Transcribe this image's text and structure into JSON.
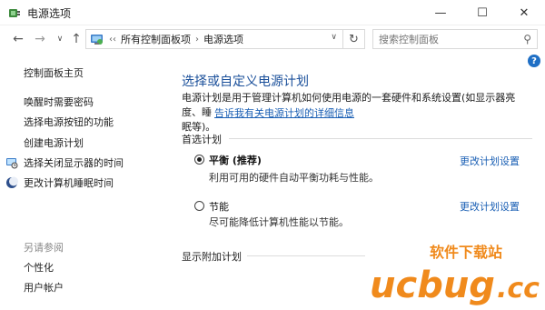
{
  "window": {
    "title": "电源选项",
    "minimize_glyph": "—",
    "maximize_glyph": "☐",
    "close_glyph": "✕"
  },
  "addressbar": {
    "back_glyph": "←",
    "forward_glyph": "→",
    "dropdown_glyph": "∨",
    "up_glyph": "↑",
    "breadcrumb_prefix": "‹‹",
    "breadcrumb_separator": "›",
    "breadcrumbs": [
      "所有控制面板项",
      "电源选项"
    ],
    "path_dropdown_glyph": "∨",
    "refresh_glyph": "↻",
    "search_placeholder": "搜索控制面板",
    "search_icon_glyph": "⚲"
  },
  "sidebar": {
    "home_label": "控制面板主页",
    "items": [
      {
        "label": "唤醒时需要密码",
        "icon": ""
      },
      {
        "label": "选择电源按钮的功能",
        "icon": ""
      },
      {
        "label": "创建电源计划",
        "icon": ""
      },
      {
        "label": "选择关闭显示器的时间",
        "icon": "display-icon"
      },
      {
        "label": "更改计算机睡眠时间",
        "icon": "moon-icon"
      }
    ],
    "see_also_heading": "另请参阅",
    "see_also": [
      {
        "label": "个性化"
      },
      {
        "label": "用户帐户"
      }
    ]
  },
  "main": {
    "help_glyph": "?",
    "title": "选择或自定义电源计划",
    "description_line1": "电源计划是用于管理计算机如何使用电源的一套硬件和系统设置(如显示器亮度、睡",
    "description_line2_prefix": "眠等)。",
    "description_link": "告诉我有关电源计划的详细信息",
    "preferred_heading": "首选计划",
    "plans": [
      {
        "name": "平衡 (推荐)",
        "desc": "利用可用的硬件自动平衡功耗与性能。",
        "selected": true,
        "link": "更改计划设置"
      },
      {
        "name": "节能",
        "desc": "尽可能降低计算机性能以节能。",
        "selected": false,
        "link": "更改计划设置"
      }
    ],
    "additional_heading": "显示附加计划"
  },
  "watermark": {
    "line1": "软件下载站",
    "line2_prefix": "ucbug",
    "line2_suffix": ".cc"
  },
  "colors": {
    "title_blue": "#1a4f9a",
    "link_blue": "#1a5fb4",
    "watermark_orange": "#f08a1c"
  }
}
